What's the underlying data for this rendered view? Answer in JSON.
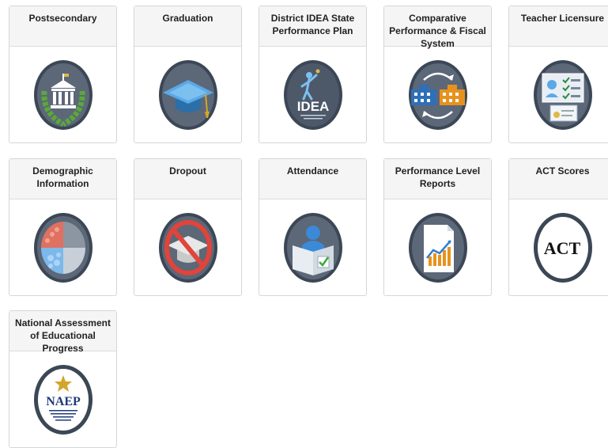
{
  "tiles": [
    {
      "title": "Postsecondary",
      "icon": "university-laurel-icon"
    },
    {
      "title": "Graduation",
      "icon": "graduation-cap-icon"
    },
    {
      "title": "District IDEA State Performance Plan",
      "icon": "idea-logo-icon",
      "icon_text": "IDEA"
    },
    {
      "title": "Comparative Performance & Fiscal System",
      "icon": "compare-buildings-icon"
    },
    {
      "title": "Teacher Licensure",
      "icon": "license-checklist-icon"
    },
    {
      "title": "Demographic Information",
      "icon": "demographic-pie-icon"
    },
    {
      "title": "Dropout",
      "icon": "no-graduation-icon"
    },
    {
      "title": "Attendance",
      "icon": "attendance-book-icon"
    },
    {
      "title": "Performance Level Reports",
      "icon": "report-chart-icon"
    },
    {
      "title": "ACT Scores",
      "icon": "act-logo-icon",
      "icon_text": "ACT"
    },
    {
      "title": "National Assessment of Educational Progress",
      "icon": "naep-logo-icon",
      "icon_text": "NAEP"
    }
  ],
  "colors": {
    "icon_ring": "#3c4756",
    "icon_fill": "#5c6778",
    "header_bg": "#f5f5f5"
  }
}
